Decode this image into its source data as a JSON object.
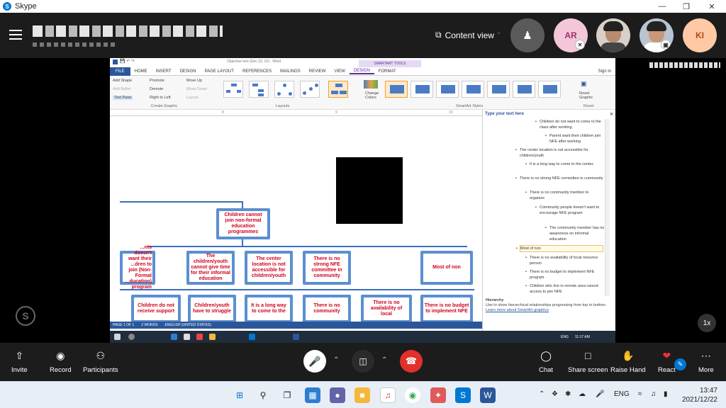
{
  "app": {
    "title": "Skype"
  },
  "header": {
    "content_view_label": "Content view",
    "avatars": [
      "AR",
      "KI"
    ]
  },
  "word": {
    "title": "Objective tree (Dec 22, 23) - Word",
    "smartart_tools": "SMARTART TOOLS",
    "tabs": [
      "FILE",
      "HOME",
      "INSERT",
      "DESIGN",
      "PAGE LAYOUT",
      "REFERENCES",
      "MAILINGS",
      "REVIEW",
      "VIEW",
      "DESIGN",
      "FORMAT"
    ],
    "sign_in": "Sign in",
    "ribbon": {
      "add_shape": "Add Shape",
      "add_bullet": "Add Bullet",
      "text_pane": "Text Pane",
      "promote": "Promote",
      "demote": "Demote",
      "right_to_left": "Right to Left",
      "move_up": "Move Up",
      "move_down": "Move Down",
      "layout": "Layout",
      "create_graphic": "Create Graphic",
      "layouts": "Layouts",
      "change_colors": "Change Colors",
      "smartart_styles": "SmartArt Styles",
      "reset_graphic": "Reset Graphic",
      "reset": "Reset"
    },
    "ruler": [
      "8",
      "9",
      "10"
    ],
    "diagram": {
      "root": "Children cannot join non-formal education programmes",
      "level1": [
        "...nts doesn't want their ...dren to join (Non-Formal ...ducation) program",
        "The children/youth cannot give time for their informal education",
        "The center location is not accessible for children/youth",
        "There is no strong NFE committee in community",
        "Most of non"
      ],
      "level2": [
        "Children do not receive support",
        "Children/youth have to struggle",
        "It is a long way to come to the",
        "There is no community",
        "There is no availability of local",
        "There is no budget to implement NFE"
      ]
    },
    "text_pane": {
      "header": "Type your text here",
      "items": [
        "Children do not want to come to the class after working.",
        "Parent want their children join NFE after working",
        "The center location is not accessible for children/youth",
        "It is a long way to come to the center.",
        "There is no strong NFE committee in community",
        "There is no community member to organize",
        "Community people doesn't want to encourage NFE program",
        "The community member has no awareness on informal education",
        "Most of non",
        "There is no availability of local resource person",
        "There is no budget to implement NFE program",
        "Children who live in remote area cannot access to join NFE"
      ],
      "footer_title": "Hierarchy",
      "footer_desc": "Use to show hierarchical relationships progressing from top to bottom.",
      "footer_link": "Learn more about SmartArt graphics"
    },
    "status": {
      "page": "PAGE 1 OF 1",
      "words": "2 WORDS",
      "language": "ENGLISH (UNITED STATES)"
    },
    "inner_taskbar": {
      "lang": "ENG",
      "time": "11:17 AM"
    }
  },
  "controls": {
    "invite": "Invite",
    "record": "Record",
    "participants": "Participants",
    "chat": "Chat",
    "share_screen": "Share screen",
    "raise_hand": "Raise Hand",
    "react": "React",
    "more": "More",
    "speed": "1x"
  },
  "taskbar": {
    "lang": "ENG",
    "time": "13:47",
    "date": "2021/12/22"
  },
  "colors": {
    "skype_blue": "#0078d4",
    "end_call": "#e0312b",
    "word_blue": "#2b579a",
    "smartart_node": "#5b8fd1",
    "node_text": "#d0021b"
  }
}
